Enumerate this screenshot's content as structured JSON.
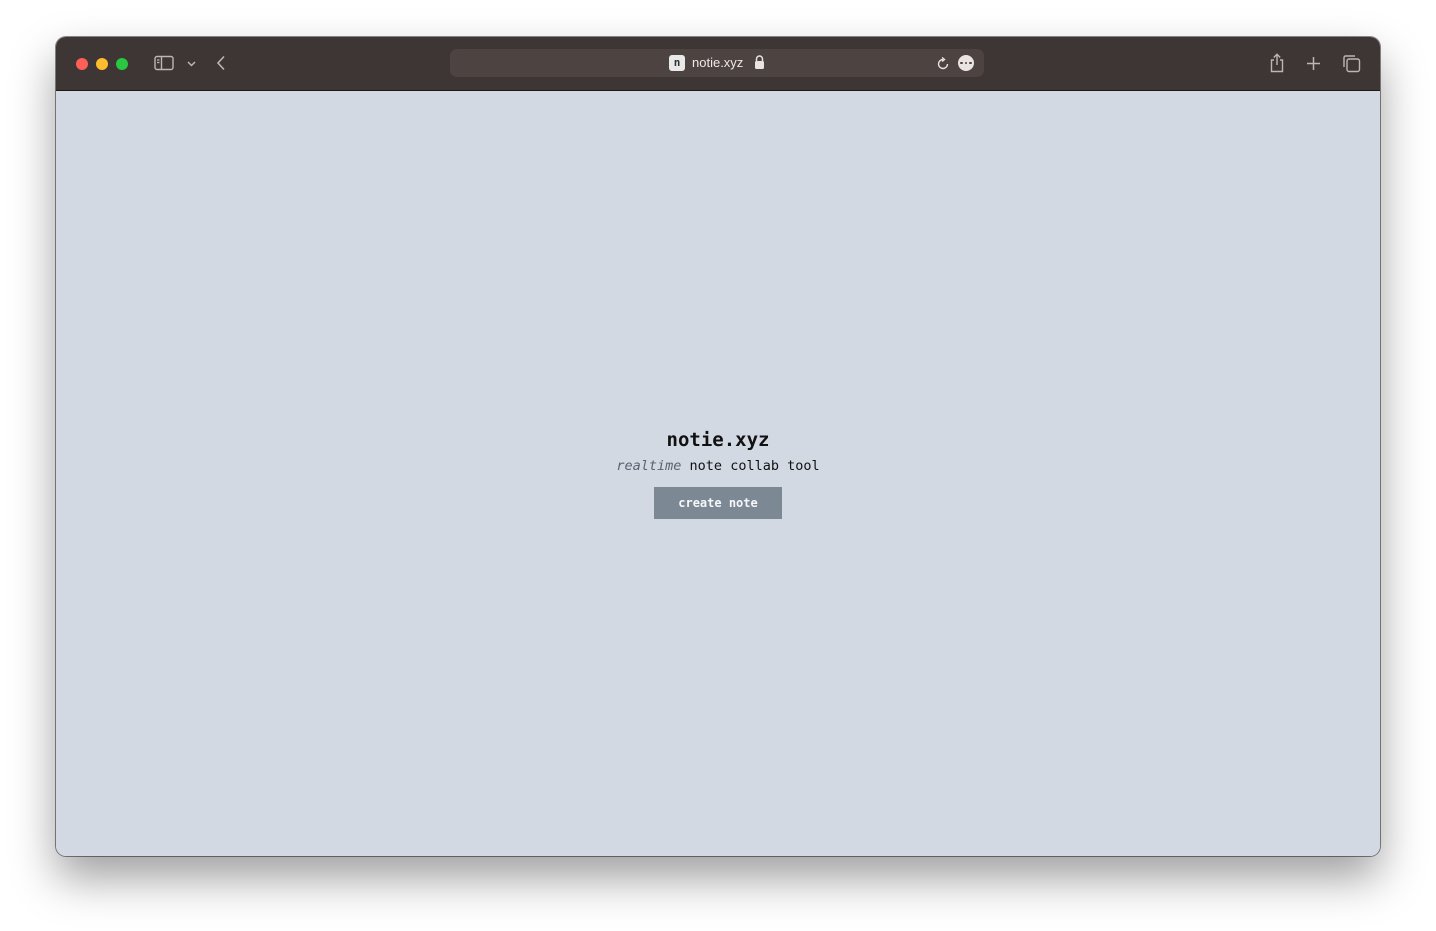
{
  "browser": {
    "url": "notie.xyz",
    "favicon_letter": "n",
    "icons": {
      "sidebar": "sidebar-icon",
      "sidebar_menu": "chevron-down-icon",
      "back": "chevron-left-icon",
      "lock": "lock-icon",
      "reload": "reload-icon",
      "more": "more-icon",
      "share": "share-icon",
      "new_tab": "plus-icon",
      "tabs": "tab-overview-icon"
    }
  },
  "page": {
    "title": "notie.xyz",
    "tagline_emphasis": "realtime",
    "tagline_rest": " note collab tool",
    "create_button_label": "create note",
    "background_color": "#d2d9e3",
    "button_color": "#7c8894"
  }
}
